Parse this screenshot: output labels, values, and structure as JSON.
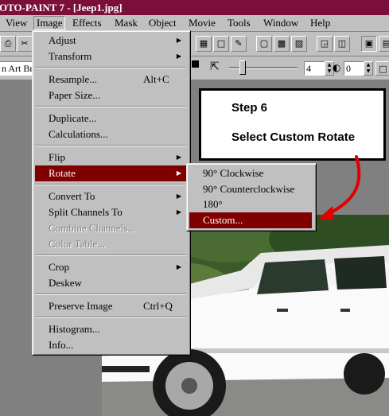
{
  "window": {
    "title": "OTO-PAINT 7 - [Jeep1.jpg]"
  },
  "menubar": {
    "items": [
      "View",
      "Image",
      "Effects",
      "Mask",
      "Object",
      "Movie",
      "Tools",
      "Window",
      "Help"
    ],
    "open": "Image"
  },
  "toolbar": {
    "brush_name": "n Art Brus",
    "size_value": "4",
    "opacity_value": "0"
  },
  "image_menu": {
    "items": [
      {
        "label": "Adjust",
        "submenu": true
      },
      {
        "label": "Transform",
        "submenu": true
      },
      {
        "label": "Resample...",
        "shortcut": "Alt+C"
      },
      {
        "label": "Paper Size..."
      },
      {
        "label": "Duplicate..."
      },
      {
        "label": "Calculations..."
      },
      {
        "label": "Flip",
        "submenu": true
      },
      {
        "label": "Rotate",
        "submenu": true,
        "highlighted": true
      },
      {
        "label": "Convert To",
        "submenu": true
      },
      {
        "label": "Split Channels To",
        "submenu": true
      },
      {
        "label": "Combine Channels...",
        "disabled": true
      },
      {
        "label": "Color Table...",
        "disabled": true
      },
      {
        "label": "Crop",
        "submenu": true
      },
      {
        "label": "Deskew"
      },
      {
        "label": "Preserve Image",
        "shortcut": "Ctrl+Q"
      },
      {
        "label": "Histogram..."
      },
      {
        "label": "Info..."
      }
    ]
  },
  "rotate_submenu": {
    "items": [
      {
        "label": "90° Clockwise"
      },
      {
        "label": "90° Counterclockwise"
      },
      {
        "label": "180°"
      },
      {
        "label": "Custom...",
        "highlighted": true
      }
    ]
  },
  "callout": {
    "step": "Step 6",
    "instruction": "Select Custom Rotate",
    "arrow_color": "#e00000"
  },
  "colors": {
    "title_bar": "#7a0f3a",
    "menu_highlight": "#800000",
    "chrome": "#c0c0c0"
  }
}
